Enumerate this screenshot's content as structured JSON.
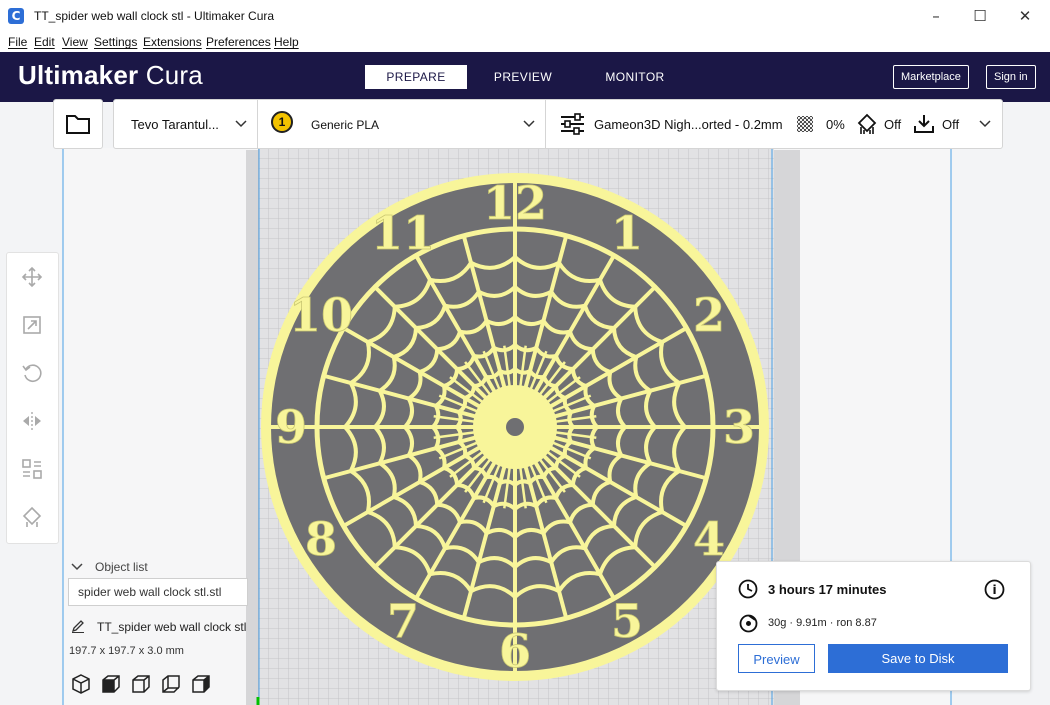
{
  "window": {
    "title": "TT_spider web wall clock stl - Ultimaker Cura",
    "app_icon": "C",
    "minimize_icon": "–",
    "maximize_icon": "☐",
    "close_icon": "✕"
  },
  "menu": [
    "File",
    "Edit",
    "View",
    "Settings",
    "Extensions",
    "Preferences",
    "Help"
  ],
  "header": {
    "brand_bold": "Ultimaker",
    "brand_light": " Cura",
    "tabs": [
      "PREPARE",
      "PREVIEW",
      "MONITOR"
    ],
    "active_tab": "PREPARE",
    "marketplace_label": "Marketplace",
    "signin_label": "Sign in"
  },
  "printer_bar": {
    "printer_name": "Tevo Tarantul...",
    "material_extruder": "1",
    "material_name": "Generic PLA",
    "profile_name": "Gameon3D Nigh...orted - 0.2mm",
    "infill_value": "0%",
    "support_value": "Off",
    "adhesion_value": "Off"
  },
  "clock": {
    "numerals": [
      "12",
      "1",
      "2",
      "3",
      "4",
      "5",
      "6",
      "7",
      "8",
      "9",
      "10",
      "11"
    ]
  },
  "object_list": {
    "heading": "Object list",
    "selected_file": "spider web wall clock stl.stl",
    "object_name": "TT_spider web wall clock stl",
    "dimensions": "197.7 x 197.7 x 3.0 mm"
  },
  "print_panel": {
    "time": "3 hours 17 minutes",
    "material_usage": "30g · 9.91m · ron 8.87",
    "info_icon": "i",
    "preview_label": "Preview",
    "save_label": "Save to Disk"
  },
  "colors": {
    "header_bg": "#1b1746",
    "accent_blue": "#2d6ed6",
    "model_yellow": "#f8f59a",
    "plate_gray": "#6f6f72"
  }
}
